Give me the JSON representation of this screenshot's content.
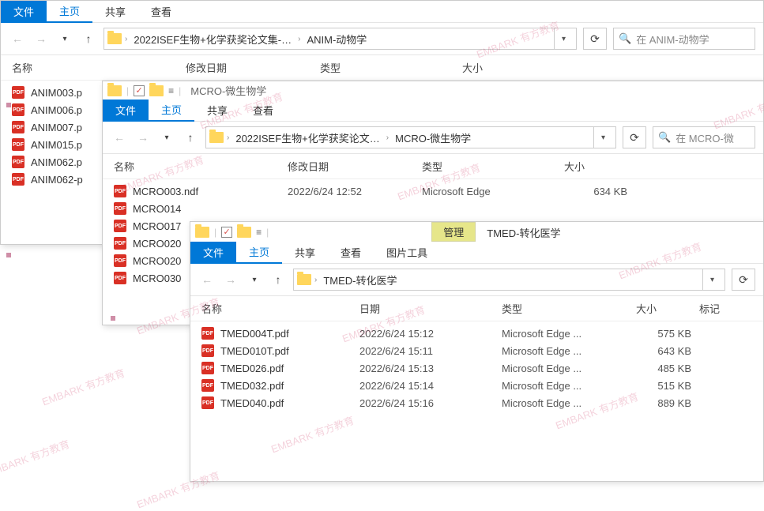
{
  "watermark": "EMBARK 有方教育",
  "tabs": {
    "file": "文件",
    "home": "主页",
    "share": "共享",
    "view": "查看",
    "manage": "管理",
    "picture_tools": "图片工具"
  },
  "headers": {
    "name": "名称",
    "date": "日期",
    "mod_date": "修改日期",
    "type": "类型",
    "size": "大小",
    "tag": "标记"
  },
  "win1": {
    "path1": "2022ISEF生物+化学获奖论文集-…",
    "path2": "ANIM-动物学",
    "search_ph": "在 ANIM-动物学",
    "files": [
      {
        "name": "ANIM003.p"
      },
      {
        "name": "ANIM006.p"
      },
      {
        "name": "ANIM007.p"
      },
      {
        "name": "ANIM015.p"
      },
      {
        "name": "ANIM062.p"
      },
      {
        "name": "ANIM062-p"
      }
    ]
  },
  "win2": {
    "title": "MCRO-微生物学",
    "path1": "2022ISEF生物+化学获奖论文…",
    "path2": "MCRO-微生物学",
    "search_ph": "在 MCRO-微",
    "row1": {
      "name": "MCRO003.ndf",
      "date": "2022/6/24 12:52",
      "type": "Microsoft Edge",
      "size": "634 KB"
    },
    "files": [
      {
        "name": "MCRO014"
      },
      {
        "name": "MCRO017"
      },
      {
        "name": "MCRO020"
      },
      {
        "name": "MCRO020"
      },
      {
        "name": "MCRO030"
      }
    ]
  },
  "win3": {
    "title": "TMED-转化医学",
    "path1": "TMED-转化医学",
    "files": [
      {
        "name": "TMED004T.pdf",
        "date": "2022/6/24 15:12",
        "type": "Microsoft Edge ...",
        "size": "575 KB"
      },
      {
        "name": "TMED010T.pdf",
        "date": "2022/6/24 15:11",
        "type": "Microsoft Edge ...",
        "size": "643 KB"
      },
      {
        "name": "TMED026.pdf",
        "date": "2022/6/24 15:13",
        "type": "Microsoft Edge ...",
        "size": "485 KB"
      },
      {
        "name": "TMED032.pdf",
        "date": "2022/6/24 15:14",
        "type": "Microsoft Edge ...",
        "size": "515 KB"
      },
      {
        "name": "TMED040.pdf",
        "date": "2022/6/24 15:16",
        "type": "Microsoft Edge ...",
        "size": "889 KB"
      }
    ]
  }
}
